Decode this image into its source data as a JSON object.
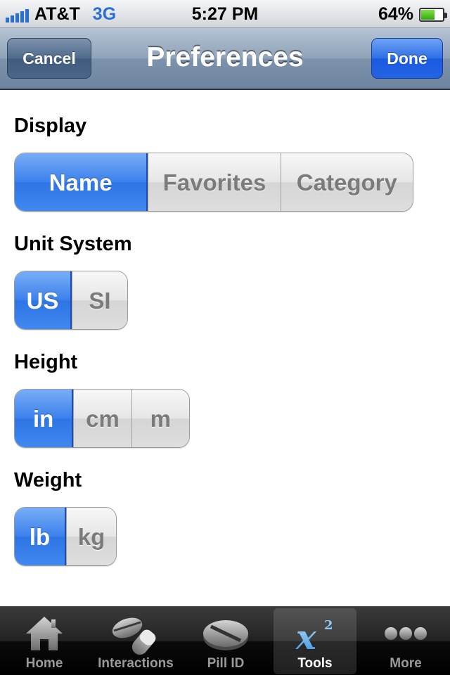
{
  "status": {
    "carrier": "AT&T",
    "network": "3G",
    "time": "5:27 PM",
    "battery": "64%",
    "battery_level": 0.64
  },
  "nav": {
    "cancel": "Cancel",
    "title": "Preferences",
    "done": "Done"
  },
  "sections": {
    "display": {
      "label": "Display",
      "options": [
        "Name",
        "Favorites",
        "Category"
      ],
      "selected": "Name"
    },
    "unit_system": {
      "label": "Unit System",
      "options": [
        "US",
        "SI"
      ],
      "selected": "US"
    },
    "height": {
      "label": "Height",
      "options": [
        "in",
        "cm",
        "m"
      ],
      "selected": "in"
    },
    "weight": {
      "label": "Weight",
      "options": [
        "lb",
        "kg"
      ],
      "selected": "lb"
    }
  },
  "tabs": [
    {
      "label": "Home",
      "icon": "house-icon",
      "selected": false
    },
    {
      "label": "Interactions",
      "icon": "pills-icon",
      "selected": false
    },
    {
      "label": "Pill ID",
      "icon": "pill-icon",
      "selected": false
    },
    {
      "label": "Tools",
      "icon": "x-squared-icon",
      "selected": true
    },
    {
      "label": "More",
      "icon": "more-dots-icon",
      "selected": false
    }
  ],
  "colors": {
    "accent": "#2f74e6",
    "nav": "#8fa2b9"
  }
}
